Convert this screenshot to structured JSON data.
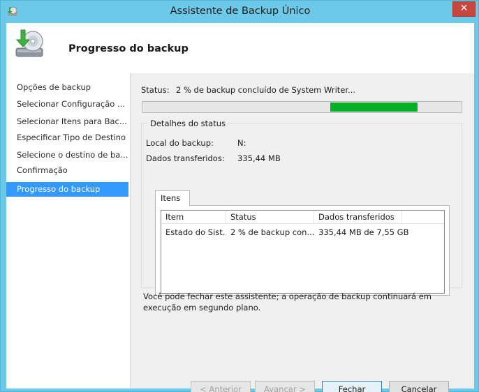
{
  "window": {
    "title": "Assistente de Backup Único"
  },
  "header": {
    "title": "Progresso do backup"
  },
  "nav": {
    "items": [
      {
        "label": "Opções de backup",
        "active": false
      },
      {
        "label": "Selecionar Configuração ...",
        "active": false
      },
      {
        "label": "Selecionar Itens para Bac...",
        "active": false
      },
      {
        "label": "Especificar Tipo de Destino",
        "active": false
      },
      {
        "label": "Selecione o destino de ba...",
        "active": false
      },
      {
        "label": "Confirmação",
        "active": false
      },
      {
        "label": "Progresso do backup",
        "active": true
      }
    ]
  },
  "status": {
    "label": "Status:",
    "text": "2 % de backup concluído de System Writer...",
    "progress": {
      "start_fraction": 0.588,
      "end_fraction": 0.863
    }
  },
  "details": {
    "legend": "Detalhes do status",
    "location_label": "Local do backup:",
    "location_value": "N:",
    "transferred_label": "Dados transferidos:",
    "transferred_value": "335,44 MB",
    "tab_label": "Itens",
    "table": {
      "columns": [
        "Item",
        "Status",
        "Dados transferidos"
      ],
      "rows": [
        [
          "Estado do Sist...",
          "2 % de backup con...",
          "335,44 MB de 7,55 GB"
        ]
      ]
    }
  },
  "note": "Você pode fechar este assistente; a operação de backup continuará em execução em segundo plano.",
  "buttons": {
    "previous": "< Anterior",
    "next": "Avançar >",
    "close": "Fechar",
    "cancel": "Cancelar"
  },
  "colors": {
    "progress_fill": "#06b025",
    "nav_selected": "#3399ff",
    "window_frame": "#6cc9e8",
    "close_button": "#c7463d"
  }
}
